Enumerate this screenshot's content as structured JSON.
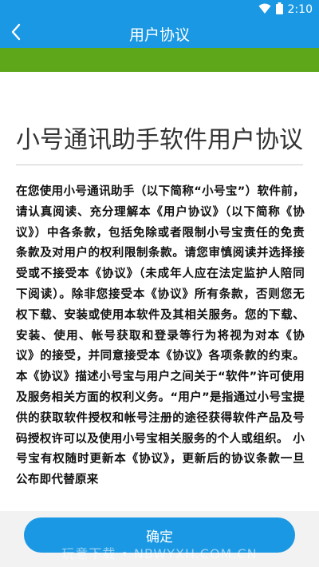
{
  "status_bar": {
    "time": "2:10",
    "icons": [
      "wifi-icon",
      "battery-icon"
    ]
  },
  "app_bar": {
    "title": "用户协议",
    "back_icon": "back-arrow-icon"
  },
  "document": {
    "title": "小号通讯助手软件用户协议",
    "body": "在您使用小号通讯助手（以下简称“小号宝”）软件前，请认真阅读、充分理解本《用户协议》（以下简称《协议》）中各条款，包括免除或者限制小号宝责任的免责条款及对用户的权利限制条款。请您审慎阅读并选择接受或不接受本《协议》（未成年人应在法定监护人陪同下阅读）。除非您接受本《协议》所有条款，否则您无权下载、安装或使用本软件及其相关服务。您的下载、安装、使用、帐号获取和登录等行为将视为对本《协议》的接受，并同意接受本《协议》各项条款的约束。 本《协议》描述小号宝与用户之间关于“软件”许可使用及服务相关方面的权利义务。“用户”是指通过小号宝提供的获取软件授权和帐号注册的途径获得软件产品及号码授权许可以及使用小号宝相关服务的个人或组织。 小号宝有权随时更新本《协议》，更新后的协议条款一旦公布即代替原来"
  },
  "footer": {
    "confirm_label": "确定",
    "watermark": "玩意下载 • NBWYXH.COM.CN"
  },
  "colors": {
    "primary_blue": "#1a98e3",
    "green_band": "#5ea61a"
  }
}
